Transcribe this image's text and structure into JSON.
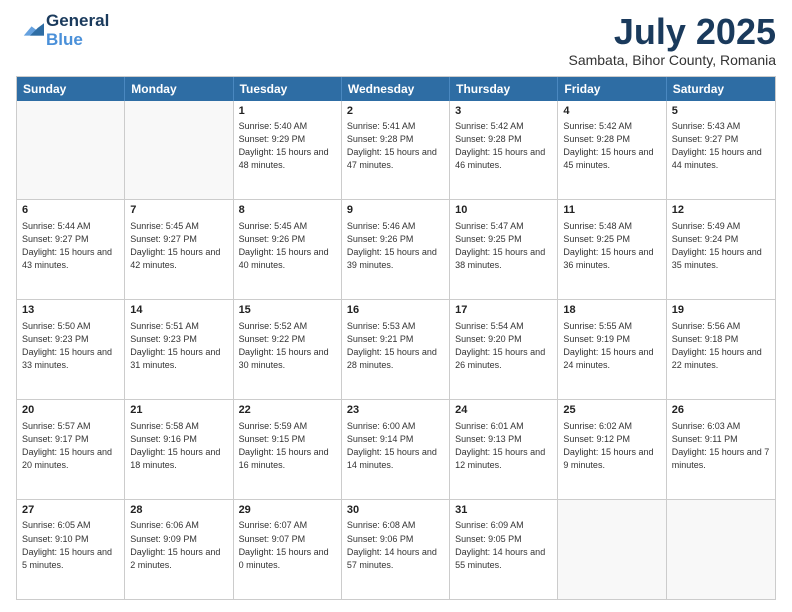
{
  "logo": {
    "line1": "General",
    "line2": "Blue"
  },
  "title": {
    "month_year": "July 2025",
    "location": "Sambata, Bihor County, Romania"
  },
  "header_days": [
    "Sunday",
    "Monday",
    "Tuesday",
    "Wednesday",
    "Thursday",
    "Friday",
    "Saturday"
  ],
  "weeks": [
    [
      {
        "day": "",
        "sunrise": "",
        "sunset": "",
        "daylight": ""
      },
      {
        "day": "",
        "sunrise": "",
        "sunset": "",
        "daylight": ""
      },
      {
        "day": "1",
        "sunrise": "Sunrise: 5:40 AM",
        "sunset": "Sunset: 9:29 PM",
        "daylight": "Daylight: 15 hours and 48 minutes."
      },
      {
        "day": "2",
        "sunrise": "Sunrise: 5:41 AM",
        "sunset": "Sunset: 9:28 PM",
        "daylight": "Daylight: 15 hours and 47 minutes."
      },
      {
        "day": "3",
        "sunrise": "Sunrise: 5:42 AM",
        "sunset": "Sunset: 9:28 PM",
        "daylight": "Daylight: 15 hours and 46 minutes."
      },
      {
        "day": "4",
        "sunrise": "Sunrise: 5:42 AM",
        "sunset": "Sunset: 9:28 PM",
        "daylight": "Daylight: 15 hours and 45 minutes."
      },
      {
        "day": "5",
        "sunrise": "Sunrise: 5:43 AM",
        "sunset": "Sunset: 9:27 PM",
        "daylight": "Daylight: 15 hours and 44 minutes."
      }
    ],
    [
      {
        "day": "6",
        "sunrise": "Sunrise: 5:44 AM",
        "sunset": "Sunset: 9:27 PM",
        "daylight": "Daylight: 15 hours and 43 minutes."
      },
      {
        "day": "7",
        "sunrise": "Sunrise: 5:45 AM",
        "sunset": "Sunset: 9:27 PM",
        "daylight": "Daylight: 15 hours and 42 minutes."
      },
      {
        "day": "8",
        "sunrise": "Sunrise: 5:45 AM",
        "sunset": "Sunset: 9:26 PM",
        "daylight": "Daylight: 15 hours and 40 minutes."
      },
      {
        "day": "9",
        "sunrise": "Sunrise: 5:46 AM",
        "sunset": "Sunset: 9:26 PM",
        "daylight": "Daylight: 15 hours and 39 minutes."
      },
      {
        "day": "10",
        "sunrise": "Sunrise: 5:47 AM",
        "sunset": "Sunset: 9:25 PM",
        "daylight": "Daylight: 15 hours and 38 minutes."
      },
      {
        "day": "11",
        "sunrise": "Sunrise: 5:48 AM",
        "sunset": "Sunset: 9:25 PM",
        "daylight": "Daylight: 15 hours and 36 minutes."
      },
      {
        "day": "12",
        "sunrise": "Sunrise: 5:49 AM",
        "sunset": "Sunset: 9:24 PM",
        "daylight": "Daylight: 15 hours and 35 minutes."
      }
    ],
    [
      {
        "day": "13",
        "sunrise": "Sunrise: 5:50 AM",
        "sunset": "Sunset: 9:23 PM",
        "daylight": "Daylight: 15 hours and 33 minutes."
      },
      {
        "day": "14",
        "sunrise": "Sunrise: 5:51 AM",
        "sunset": "Sunset: 9:23 PM",
        "daylight": "Daylight: 15 hours and 31 minutes."
      },
      {
        "day": "15",
        "sunrise": "Sunrise: 5:52 AM",
        "sunset": "Sunset: 9:22 PM",
        "daylight": "Daylight: 15 hours and 30 minutes."
      },
      {
        "day": "16",
        "sunrise": "Sunrise: 5:53 AM",
        "sunset": "Sunset: 9:21 PM",
        "daylight": "Daylight: 15 hours and 28 minutes."
      },
      {
        "day": "17",
        "sunrise": "Sunrise: 5:54 AM",
        "sunset": "Sunset: 9:20 PM",
        "daylight": "Daylight: 15 hours and 26 minutes."
      },
      {
        "day": "18",
        "sunrise": "Sunrise: 5:55 AM",
        "sunset": "Sunset: 9:19 PM",
        "daylight": "Daylight: 15 hours and 24 minutes."
      },
      {
        "day": "19",
        "sunrise": "Sunrise: 5:56 AM",
        "sunset": "Sunset: 9:18 PM",
        "daylight": "Daylight: 15 hours and 22 minutes."
      }
    ],
    [
      {
        "day": "20",
        "sunrise": "Sunrise: 5:57 AM",
        "sunset": "Sunset: 9:17 PM",
        "daylight": "Daylight: 15 hours and 20 minutes."
      },
      {
        "day": "21",
        "sunrise": "Sunrise: 5:58 AM",
        "sunset": "Sunset: 9:16 PM",
        "daylight": "Daylight: 15 hours and 18 minutes."
      },
      {
        "day": "22",
        "sunrise": "Sunrise: 5:59 AM",
        "sunset": "Sunset: 9:15 PM",
        "daylight": "Daylight: 15 hours and 16 minutes."
      },
      {
        "day": "23",
        "sunrise": "Sunrise: 6:00 AM",
        "sunset": "Sunset: 9:14 PM",
        "daylight": "Daylight: 15 hours and 14 minutes."
      },
      {
        "day": "24",
        "sunrise": "Sunrise: 6:01 AM",
        "sunset": "Sunset: 9:13 PM",
        "daylight": "Daylight: 15 hours and 12 minutes."
      },
      {
        "day": "25",
        "sunrise": "Sunrise: 6:02 AM",
        "sunset": "Sunset: 9:12 PM",
        "daylight": "Daylight: 15 hours and 9 minutes."
      },
      {
        "day": "26",
        "sunrise": "Sunrise: 6:03 AM",
        "sunset": "Sunset: 9:11 PM",
        "daylight": "Daylight: 15 hours and 7 minutes."
      }
    ],
    [
      {
        "day": "27",
        "sunrise": "Sunrise: 6:05 AM",
        "sunset": "Sunset: 9:10 PM",
        "daylight": "Daylight: 15 hours and 5 minutes."
      },
      {
        "day": "28",
        "sunrise": "Sunrise: 6:06 AM",
        "sunset": "Sunset: 9:09 PM",
        "daylight": "Daylight: 15 hours and 2 minutes."
      },
      {
        "day": "29",
        "sunrise": "Sunrise: 6:07 AM",
        "sunset": "Sunset: 9:07 PM",
        "daylight": "Daylight: 15 hours and 0 minutes."
      },
      {
        "day": "30",
        "sunrise": "Sunrise: 6:08 AM",
        "sunset": "Sunset: 9:06 PM",
        "daylight": "Daylight: 14 hours and 57 minutes."
      },
      {
        "day": "31",
        "sunrise": "Sunrise: 6:09 AM",
        "sunset": "Sunset: 9:05 PM",
        "daylight": "Daylight: 14 hours and 55 minutes."
      },
      {
        "day": "",
        "sunrise": "",
        "sunset": "",
        "daylight": ""
      },
      {
        "day": "",
        "sunrise": "",
        "sunset": "",
        "daylight": ""
      }
    ]
  ]
}
